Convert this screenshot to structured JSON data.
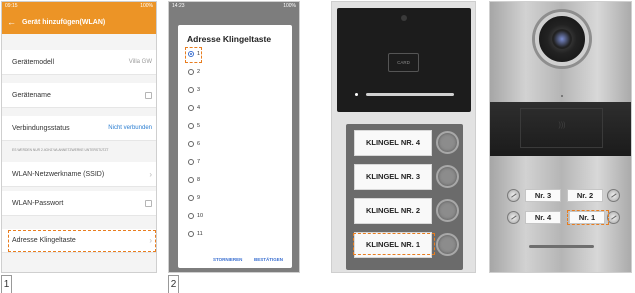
{
  "panel1": {
    "status_time": "09:15",
    "status_right": "100%",
    "title": "Gerät hinzufügen(WLAN)",
    "rows": [
      {
        "label": "Gerätemodell",
        "value": "Villa GW"
      },
      {
        "label": "Gerätename",
        "value": ""
      },
      {
        "label": "Verbindungsstatus",
        "value": "Nicht verbunden"
      },
      {
        "label": "WLAN-Netzwerkname (SSID)",
        "value": ""
      },
      {
        "label": "WLAN-Passwort",
        "value": ""
      },
      {
        "label": "Adresse Klingeltaste",
        "value": ""
      }
    ],
    "note": "ES WERDEN NUR 2.4GHZ WLANNETZWERKE UNTERSTÜTZT",
    "number": "1"
  },
  "panel2": {
    "status_time": "14:23",
    "status_right": "100%",
    "title": "Adresse Klingeltaste",
    "options": [
      "1",
      "2",
      "3",
      "4",
      "5",
      "6",
      "7",
      "8",
      "9",
      "10",
      "11"
    ],
    "selected_index": 0,
    "cancel": "STORNIEREN",
    "confirm": "BESTÄTIGEN",
    "number": "2"
  },
  "panel3": {
    "card_label": "CARD",
    "plates": [
      "KLINGEL NR. 4",
      "KLINGEL NR. 3",
      "KLINGEL NR. 2",
      "KLINGEL NR. 1"
    ]
  },
  "panel4": {
    "row1": [
      "Nr. 3",
      "Nr. 2"
    ],
    "row2": [
      "Nr. 4",
      "Nr. 1"
    ]
  },
  "colors": {
    "accent": "#ec9426",
    "highlight": "#e87d1f",
    "link": "#2a7dd1",
    "radio": "#3a6fd0"
  }
}
